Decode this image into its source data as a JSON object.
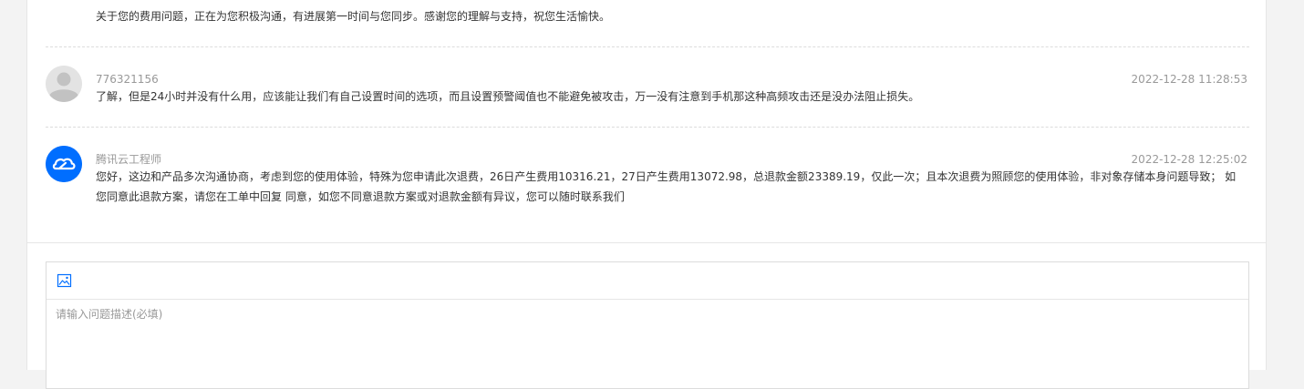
{
  "thread": {
    "prev_message_text": "关于您的费用问题，正在为您积极沟通，有进展第一时间与您同步。感谢您的理解与支持，祝您生活愉快。",
    "messages": [
      {
        "author": "776321156",
        "time": "2022-12-28 11:28:53",
        "text": "了解，但是24小时并没有什么用，应该能让我们有自己设置时间的选项，而且设置预警阈值也不能避免被攻击，万一没有注意到手机那这种高频攻击还是没办法阻止损失。",
        "avatar_icon": "default-user-avatar-icon"
      },
      {
        "author": "腾讯云工程师",
        "time": "2022-12-28 12:25:02",
        "text": "您好，这边和产品多次沟通协商，考虑到您的使用体验，特殊为您申请此次退费，26日产生费用10316.21，27日产生费用13072.98，总退款金额23389.19，仅此一次；且本次退费为照顾您的使用体验，非对象存储本身问题导致； 如您同意此退款方案，请您在工单中回复 同意，如您不同意退款方案或对退款金额有异议，您可以随时联系我们",
        "avatar_icon": "tencent-cloud-logo-icon"
      }
    ]
  },
  "reply": {
    "toolbar_icon": "insert-image-icon",
    "placeholder": "请输入问题描述(必填)"
  },
  "colors": {
    "page_bg": "#f3f3f3",
    "brand_blue": "#006eff",
    "meta_text": "#999999",
    "body_text": "#333333"
  }
}
